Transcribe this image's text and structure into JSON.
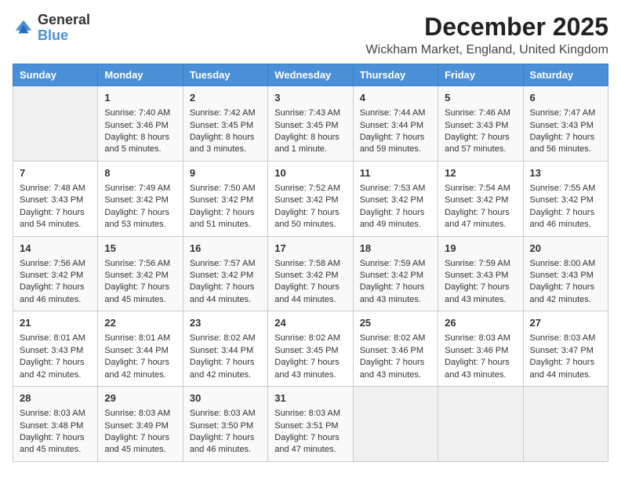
{
  "logo": {
    "general": "General",
    "blue": "Blue"
  },
  "header": {
    "title": "December 2025",
    "subtitle": "Wickham Market, England, United Kingdom"
  },
  "days_of_week": [
    "Sunday",
    "Monday",
    "Tuesday",
    "Wednesday",
    "Thursday",
    "Friday",
    "Saturday"
  ],
  "weeks": [
    [
      {
        "day": "",
        "sunrise": "",
        "sunset": "",
        "daylight": ""
      },
      {
        "day": "1",
        "sunrise": "Sunrise: 7:40 AM",
        "sunset": "Sunset: 3:46 PM",
        "daylight": "Daylight: 8 hours and 5 minutes."
      },
      {
        "day": "2",
        "sunrise": "Sunrise: 7:42 AM",
        "sunset": "Sunset: 3:45 PM",
        "daylight": "Daylight: 8 hours and 3 minutes."
      },
      {
        "day": "3",
        "sunrise": "Sunrise: 7:43 AM",
        "sunset": "Sunset: 3:45 PM",
        "daylight": "Daylight: 8 hours and 1 minute."
      },
      {
        "day": "4",
        "sunrise": "Sunrise: 7:44 AM",
        "sunset": "Sunset: 3:44 PM",
        "daylight": "Daylight: 7 hours and 59 minutes."
      },
      {
        "day": "5",
        "sunrise": "Sunrise: 7:46 AM",
        "sunset": "Sunset: 3:43 PM",
        "daylight": "Daylight: 7 hours and 57 minutes."
      },
      {
        "day": "6",
        "sunrise": "Sunrise: 7:47 AM",
        "sunset": "Sunset: 3:43 PM",
        "daylight": "Daylight: 7 hours and 56 minutes."
      }
    ],
    [
      {
        "day": "7",
        "sunrise": "Sunrise: 7:48 AM",
        "sunset": "Sunset: 3:43 PM",
        "daylight": "Daylight: 7 hours and 54 minutes."
      },
      {
        "day": "8",
        "sunrise": "Sunrise: 7:49 AM",
        "sunset": "Sunset: 3:42 PM",
        "daylight": "Daylight: 7 hours and 53 minutes."
      },
      {
        "day": "9",
        "sunrise": "Sunrise: 7:50 AM",
        "sunset": "Sunset: 3:42 PM",
        "daylight": "Daylight: 7 hours and 51 minutes."
      },
      {
        "day": "10",
        "sunrise": "Sunrise: 7:52 AM",
        "sunset": "Sunset: 3:42 PM",
        "daylight": "Daylight: 7 hours and 50 minutes."
      },
      {
        "day": "11",
        "sunrise": "Sunrise: 7:53 AM",
        "sunset": "Sunset: 3:42 PM",
        "daylight": "Daylight: 7 hours and 49 minutes."
      },
      {
        "day": "12",
        "sunrise": "Sunrise: 7:54 AM",
        "sunset": "Sunset: 3:42 PM",
        "daylight": "Daylight: 7 hours and 47 minutes."
      },
      {
        "day": "13",
        "sunrise": "Sunrise: 7:55 AM",
        "sunset": "Sunset: 3:42 PM",
        "daylight": "Daylight: 7 hours and 46 minutes."
      }
    ],
    [
      {
        "day": "14",
        "sunrise": "Sunrise: 7:56 AM",
        "sunset": "Sunset: 3:42 PM",
        "daylight": "Daylight: 7 hours and 46 minutes."
      },
      {
        "day": "15",
        "sunrise": "Sunrise: 7:56 AM",
        "sunset": "Sunset: 3:42 PM",
        "daylight": "Daylight: 7 hours and 45 minutes."
      },
      {
        "day": "16",
        "sunrise": "Sunrise: 7:57 AM",
        "sunset": "Sunset: 3:42 PM",
        "daylight": "Daylight: 7 hours and 44 minutes."
      },
      {
        "day": "17",
        "sunrise": "Sunrise: 7:58 AM",
        "sunset": "Sunset: 3:42 PM",
        "daylight": "Daylight: 7 hours and 44 minutes."
      },
      {
        "day": "18",
        "sunrise": "Sunrise: 7:59 AM",
        "sunset": "Sunset: 3:42 PM",
        "daylight": "Daylight: 7 hours and 43 minutes."
      },
      {
        "day": "19",
        "sunrise": "Sunrise: 7:59 AM",
        "sunset": "Sunset: 3:43 PM",
        "daylight": "Daylight: 7 hours and 43 minutes."
      },
      {
        "day": "20",
        "sunrise": "Sunrise: 8:00 AM",
        "sunset": "Sunset: 3:43 PM",
        "daylight": "Daylight: 7 hours and 42 minutes."
      }
    ],
    [
      {
        "day": "21",
        "sunrise": "Sunrise: 8:01 AM",
        "sunset": "Sunset: 3:43 PM",
        "daylight": "Daylight: 7 hours and 42 minutes."
      },
      {
        "day": "22",
        "sunrise": "Sunrise: 8:01 AM",
        "sunset": "Sunset: 3:44 PM",
        "daylight": "Daylight: 7 hours and 42 minutes."
      },
      {
        "day": "23",
        "sunrise": "Sunrise: 8:02 AM",
        "sunset": "Sunset: 3:44 PM",
        "daylight": "Daylight: 7 hours and 42 minutes."
      },
      {
        "day": "24",
        "sunrise": "Sunrise: 8:02 AM",
        "sunset": "Sunset: 3:45 PM",
        "daylight": "Daylight: 7 hours and 43 minutes."
      },
      {
        "day": "25",
        "sunrise": "Sunrise: 8:02 AM",
        "sunset": "Sunset: 3:46 PM",
        "daylight": "Daylight: 7 hours and 43 minutes."
      },
      {
        "day": "26",
        "sunrise": "Sunrise: 8:03 AM",
        "sunset": "Sunset: 3:46 PM",
        "daylight": "Daylight: 7 hours and 43 minutes."
      },
      {
        "day": "27",
        "sunrise": "Sunrise: 8:03 AM",
        "sunset": "Sunset: 3:47 PM",
        "daylight": "Daylight: 7 hours and 44 minutes."
      }
    ],
    [
      {
        "day": "28",
        "sunrise": "Sunrise: 8:03 AM",
        "sunset": "Sunset: 3:48 PM",
        "daylight": "Daylight: 7 hours and 45 minutes."
      },
      {
        "day": "29",
        "sunrise": "Sunrise: 8:03 AM",
        "sunset": "Sunset: 3:49 PM",
        "daylight": "Daylight: 7 hours and 45 minutes."
      },
      {
        "day": "30",
        "sunrise": "Sunrise: 8:03 AM",
        "sunset": "Sunset: 3:50 PM",
        "daylight": "Daylight: 7 hours and 46 minutes."
      },
      {
        "day": "31",
        "sunrise": "Sunrise: 8:03 AM",
        "sunset": "Sunset: 3:51 PM",
        "daylight": "Daylight: 7 hours and 47 minutes."
      },
      {
        "day": "",
        "sunrise": "",
        "sunset": "",
        "daylight": ""
      },
      {
        "day": "",
        "sunrise": "",
        "sunset": "",
        "daylight": ""
      },
      {
        "day": "",
        "sunrise": "",
        "sunset": "",
        "daylight": ""
      }
    ]
  ]
}
